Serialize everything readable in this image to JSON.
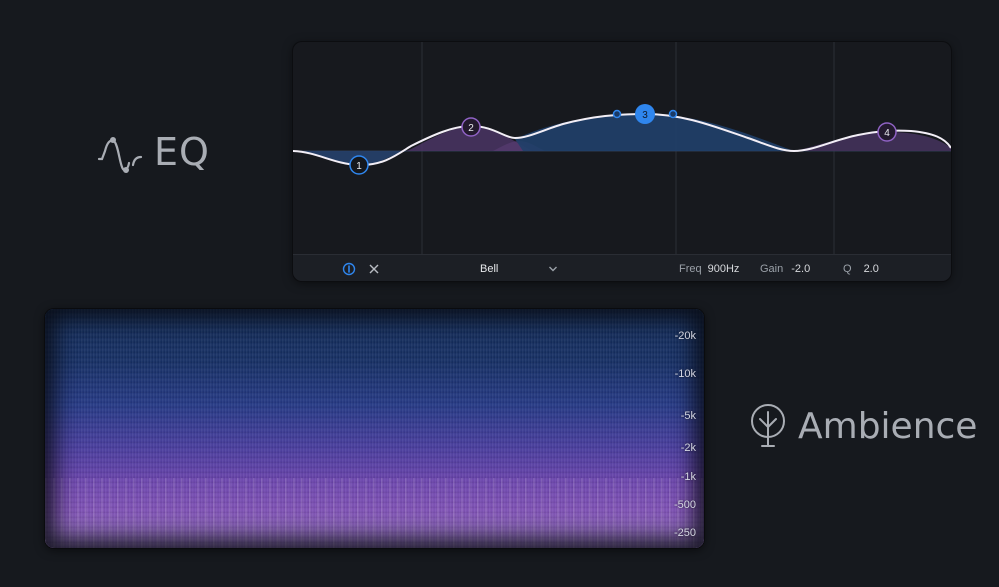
{
  "eq": {
    "title": "EQ",
    "icon": "eq-curve-icon",
    "bands": [
      {
        "id": "1",
        "selected": false
      },
      {
        "id": "2",
        "selected": false
      },
      {
        "id": "3",
        "selected": true
      },
      {
        "id": "4",
        "selected": false
      }
    ],
    "footer": {
      "filter_type": "Bell",
      "freq_label": "Freq",
      "freq_value": "900Hz",
      "gain_label": "Gain",
      "gain_value": "-2.0",
      "q_label": "Q",
      "q_value": "2.0"
    },
    "colors": {
      "accent": "#2f86ee",
      "curve": "#f2eef6",
      "band_purple": "#7a4fa8"
    }
  },
  "ambience": {
    "title": "Ambience",
    "icon": "tree-icon"
  },
  "spectrogram": {
    "ticks": [
      "-20k",
      "-10k",
      "-5k",
      "-2k",
      "-1k",
      "-500",
      "-250"
    ]
  }
}
